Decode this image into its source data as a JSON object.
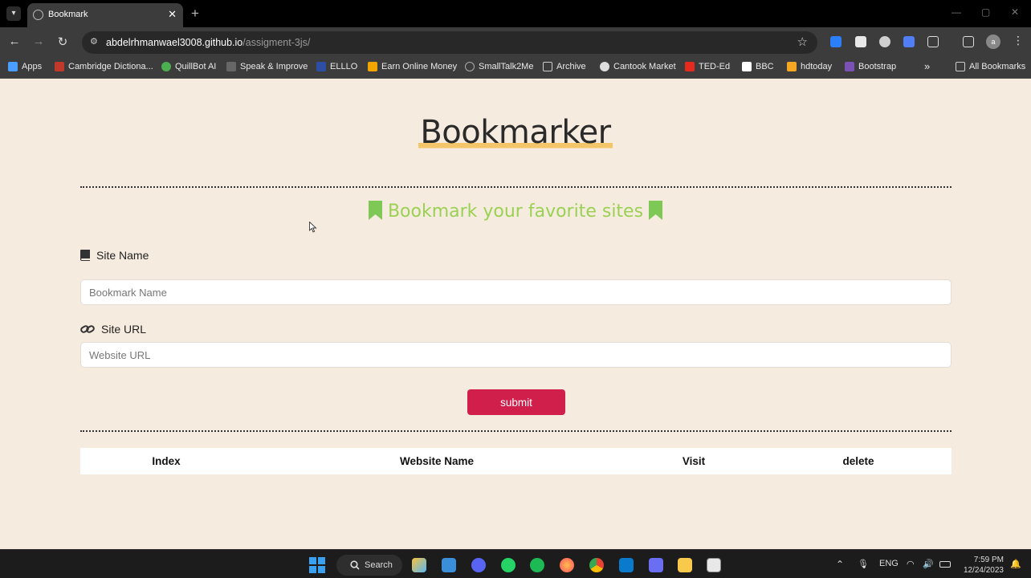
{
  "browser": {
    "tab_title": "Bookmark",
    "url_host": "abdelrhmanwael3008.github.io",
    "url_path": "/assigment-3js/",
    "bookmarks": [
      {
        "label": "Apps",
        "icon": "apps-grid-icon",
        "color": "#4a9eff"
      },
      {
        "label": "Cambridge Dictiona...",
        "icon": "cambridge-icon",
        "color": "#c0392b"
      },
      {
        "label": "QuillBot AI",
        "icon": "quillbot-icon",
        "color": "#4caf50"
      },
      {
        "label": "Speak & Improve",
        "icon": "speak-improve-icon",
        "color": "#666666"
      },
      {
        "label": "ELLLO",
        "icon": "elllo-icon",
        "color": "#2c4fa3"
      },
      {
        "label": "Earn Online Money",
        "icon": "earn-money-icon",
        "color": "#f0a500"
      },
      {
        "label": "SmallTalk2Me",
        "icon": "smalltalk-icon",
        "color": "#888888"
      },
      {
        "label": "Archive",
        "icon": "archive-icon",
        "color": "#cccccc"
      },
      {
        "label": "Cantook Market",
        "icon": "cantook-icon",
        "color": "#dddddd"
      },
      {
        "label": "TED-Ed",
        "icon": "ted-ed-icon",
        "color": "#e62b1e"
      },
      {
        "label": "BBC",
        "icon": "bbc-icon",
        "color": "#ffffff"
      },
      {
        "label": "hdtoday",
        "icon": "hdtoday-icon",
        "color": "#f5a623"
      },
      {
        "label": "Bootstrap",
        "icon": "bootstrap-icon",
        "color": "#7952b3"
      }
    ],
    "more_bookmarks": "»",
    "all_bookmarks": "All Bookmarks"
  },
  "page": {
    "title": "Bookmarker",
    "subtitle": "Bookmark your favorite sites",
    "site_name_label": "Site Name",
    "site_name_placeholder": "Bookmark Name",
    "site_url_label": "Site URL",
    "site_url_placeholder": "Website URL",
    "submit_label": "submit",
    "table_headers": [
      "Index",
      "Website Name",
      "Visit",
      "delete"
    ],
    "colors": {
      "background": "#f6ebdf",
      "subtitle": "#9ad153",
      "title_highlight": "#f5c56a",
      "submit": "#d01f4a"
    }
  },
  "taskbar": {
    "search_label": "Search",
    "language": "ENG",
    "time": "7:59 PM",
    "date": "12/24/2023"
  }
}
